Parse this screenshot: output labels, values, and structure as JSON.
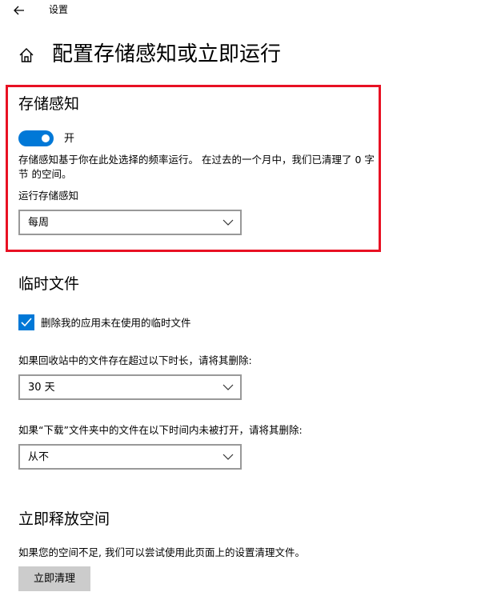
{
  "topbar": {
    "back_icon": "back-arrow-icon",
    "title": "设置"
  },
  "page": {
    "home_icon": "home-icon",
    "title": "配置存储感知或立即运行"
  },
  "storage_sense": {
    "heading": "存储感知",
    "toggle": {
      "state_on": true,
      "label": "开",
      "accent_color": "#0078d7"
    },
    "description": "存储感知基于你在此处选择的频率运行。 在过去的一个月中，我们已清理了 0 字节 的空间。",
    "run_label": "运行存储感知",
    "run_frequency": {
      "selected": "每周"
    },
    "highlight_color": "#e81123"
  },
  "temp_files": {
    "heading": "临时文件",
    "delete_temp_checkbox": {
      "checked": true,
      "label": "删除我的应用未在使用的临时文件"
    },
    "recycle_bin_label": "如果回收站中的文件存在超过以下时长，请将其删除:",
    "recycle_bin_select": {
      "selected": "30 天"
    },
    "downloads_label": "如果“下载”文件夹中的文件在以下时间内未被打开，请将其删除:",
    "downloads_select": {
      "selected": "从不"
    }
  },
  "free_space": {
    "heading": "立即释放空间",
    "description": "如果您的空间不足, 我们可以尝试使用此页面上的设置清理文件。",
    "clean_now_button": "立即清理"
  }
}
